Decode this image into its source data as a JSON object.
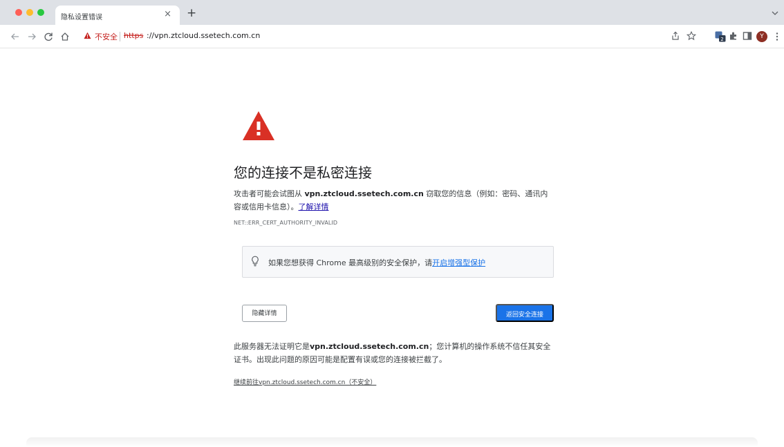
{
  "tab": {
    "title": "隐私设置错误",
    "close_label": "×",
    "new_tab_label": "+"
  },
  "toolbar": {
    "security_label": "不安全",
    "url_scheme": "https",
    "url_rest": "://vpn.ztcloud.ssetech.com.cn",
    "avatar_initial": "Y",
    "ext_badge_count": "2"
  },
  "page": {
    "heading": "您的连接不是私密连接",
    "desc_prefix": "攻击者可能会试图从 ",
    "desc_host": "vpn.ztcloud.ssetech.com.cn",
    "desc_middle": " 窃取您的信息（例如：密码、通讯内容或信用卡信息）。",
    "learn_more": "了解详情",
    "error_code": "NET::ERR_CERT_AUTHORITY_INVALID",
    "promo_text": "如果您想获得 Chrome 最高级别的安全保护，请",
    "promo_link": "开启增强型保护",
    "hide_details": "隐藏详情",
    "back_to_safety": "返回安全连接",
    "detail_prefix": "此服务器无法证明它是",
    "detail_host": "vpn.ztcloud.ssetech.com.cn",
    "detail_suffix": "；您计算机的操作系统不信任其安全证书。出现此问题的原因可能是配置有误或您的连接被拦截了。",
    "proceed_link": "继续前往vpn.ztcloud.ssetech.com.cn（不安全）"
  },
  "colors": {
    "warning_red": "#d93025",
    "primary_blue": "#1a73e8",
    "tabstrip_bg": "#dee1e6"
  }
}
